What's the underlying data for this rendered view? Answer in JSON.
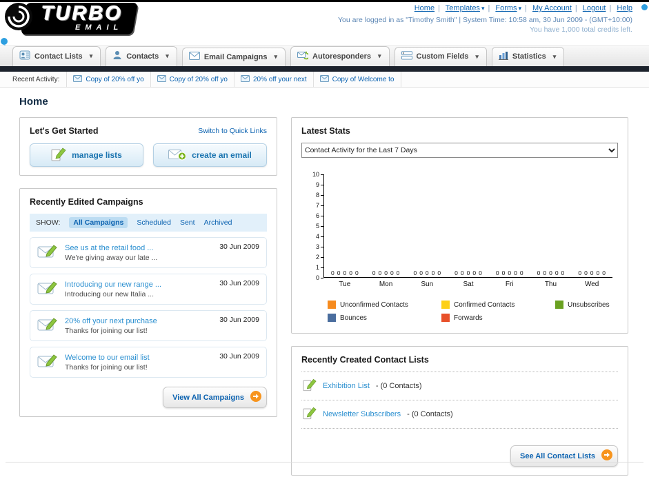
{
  "brand": {
    "logo_title": "TURBO",
    "logo_subtitle": "EMAIL"
  },
  "top_nav": {
    "links": [
      {
        "label": "Home"
      },
      {
        "label": "Templates"
      },
      {
        "label": "Forms"
      },
      {
        "label": "My Account"
      },
      {
        "label": "Logout"
      },
      {
        "label": "Help"
      }
    ],
    "login_info": "You are logged in as \"Timothy Smith\" | System Time: 10:58 am, 30 Jun 2009 - (GMT+10:00)",
    "credits_info": "You have 1,000 total credits left."
  },
  "main_nav": {
    "tabs": [
      {
        "label": "Contact Lists"
      },
      {
        "label": "Contacts"
      },
      {
        "label": "Email Campaigns"
      },
      {
        "label": "Autoresponders"
      },
      {
        "label": "Custom Fields"
      },
      {
        "label": "Statistics"
      }
    ]
  },
  "recent_activity": {
    "label": "Recent Activity:",
    "items": [
      {
        "label": "Copy of 20% off yo"
      },
      {
        "label": "Copy of 20% off yo"
      },
      {
        "label": "20% off your next"
      },
      {
        "label": "Copy of Welcome to"
      }
    ]
  },
  "page_title": "Home",
  "get_started": {
    "title": "Let's Get Started",
    "switch_link": "Switch to Quick Links",
    "manage_lists_label": "manage lists",
    "create_email_label": "create an email"
  },
  "campaigns": {
    "title": "Recently Edited Campaigns",
    "show_label": "SHOW:",
    "filters": [
      {
        "label": "All Campaigns",
        "active": true
      },
      {
        "label": "Scheduled",
        "active": false
      },
      {
        "label": "Sent",
        "active": false
      },
      {
        "label": "Archived",
        "active": false
      }
    ],
    "items": [
      {
        "title": "See us at the retail food ...",
        "subtitle": "We're giving away our late ...",
        "date": "30 Jun 2009"
      },
      {
        "title": "Introducing our new range ...",
        "subtitle": "Introducing our new Italia ...",
        "date": "30 Jun 2009"
      },
      {
        "title": "20% off your next purchase",
        "subtitle": "Thanks for joining our list!",
        "date": "30 Jun 2009"
      },
      {
        "title": "Welcome to our email list",
        "subtitle": "Thanks for joining our list!",
        "date": "30 Jun 2009"
      }
    ],
    "view_all_label": "View All Campaigns"
  },
  "stats": {
    "title": "Latest Stats",
    "selected_option": "Contact Activity for the Last 7 Days",
    "chart_data": {
      "type": "bar",
      "categories": [
        "Tue",
        "Mon",
        "Sun",
        "Sat",
        "Fri",
        "Thu",
        "Wed"
      ],
      "series": [
        {
          "name": "Unconfirmed Contacts",
          "color": "#f68b1f",
          "values": [
            0,
            0,
            0,
            0,
            0,
            0,
            0
          ]
        },
        {
          "name": "Confirmed Contacts",
          "color": "#fdd017",
          "values": [
            0,
            0,
            0,
            0,
            0,
            0,
            0
          ]
        },
        {
          "name": "Unsubscribes",
          "color": "#6aa121",
          "values": [
            0,
            0,
            0,
            0,
            0,
            0,
            0
          ]
        },
        {
          "name": "Bounces",
          "color": "#4a6d9e",
          "values": [
            0,
            0,
            0,
            0,
            0,
            0,
            0
          ]
        },
        {
          "name": "Forwards",
          "color": "#e8502a",
          "values": [
            0,
            0,
            0,
            0,
            0,
            0,
            0
          ]
        }
      ],
      "ylim": [
        0,
        10
      ],
      "yticks": [
        0,
        1,
        2,
        3,
        4,
        5,
        6,
        7,
        8,
        9,
        10
      ],
      "grid": false,
      "legend_position": "bottom"
    }
  },
  "contact_lists": {
    "title": "Recently Created Contact Lists",
    "items": [
      {
        "name": "Exhibition List",
        "suffix": "- (0 Contacts)"
      },
      {
        "name": "Newsletter Subscribers",
        "suffix": "- (0 Contacts)"
      }
    ],
    "see_all_label": "See All Contact Lists"
  }
}
